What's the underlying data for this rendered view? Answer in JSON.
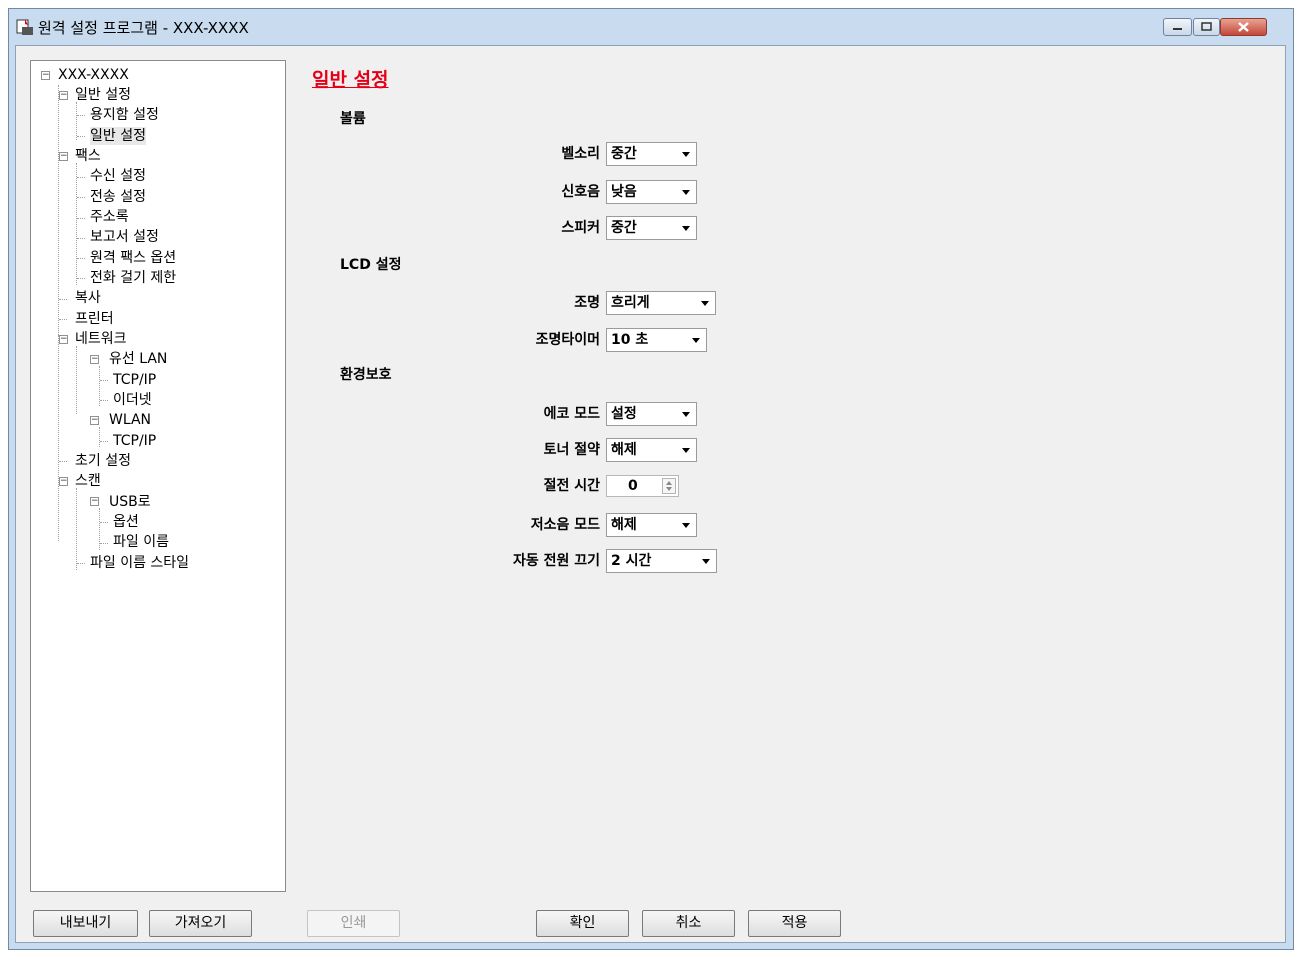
{
  "window": {
    "title": "원격 설정 프로그램 - XXX-XXXX",
    "controls": [
      "minimize-icon",
      "maximize-icon",
      "close-icon"
    ]
  },
  "tree": {
    "items": [
      {
        "label": "XXX-XXXX"
      },
      {
        "label": "일반 설정"
      },
      {
        "label": "용지함 설정"
      },
      {
        "label": "일반 설정",
        "selected": true
      },
      {
        "label": "팩스"
      },
      {
        "label": "수신 설정"
      },
      {
        "label": "전송 설정"
      },
      {
        "label": "주소록"
      },
      {
        "label": "보고서 설정"
      },
      {
        "label": "원격 팩스 옵션"
      },
      {
        "label": "전화 걸기 제한"
      },
      {
        "label": "복사"
      },
      {
        "label": "프린터"
      },
      {
        "label": "네트워크"
      },
      {
        "label": "유선 LAN"
      },
      {
        "label": "TCP/IP"
      },
      {
        "label": "이더넷"
      },
      {
        "label": "WLAN"
      },
      {
        "label": "TCP/IP"
      },
      {
        "label": "초기 설정"
      },
      {
        "label": "스캔"
      },
      {
        "label": "USB로"
      },
      {
        "label": "옵션"
      },
      {
        "label": "파일 이름"
      },
      {
        "label": "파일 이름 스타일"
      }
    ]
  },
  "main": {
    "page_title": "일반 설정",
    "sections": {
      "volume": "볼륨",
      "lcd": "LCD 설정",
      "eco": "환경보호"
    },
    "fields": {
      "ring": {
        "label": "벨소리",
        "value": "중간"
      },
      "beep": {
        "label": "신호음",
        "value": "낮음"
      },
      "speaker": {
        "label": "스피커",
        "value": "중간"
      },
      "backlight": {
        "label": "조명",
        "value": "흐리게"
      },
      "dim_timer": {
        "label": "조명타이머",
        "value": "10 초"
      },
      "eco_mode": {
        "label": "에코 모드",
        "value": "설정"
      },
      "toner_save": {
        "label": "토너 절약",
        "value": "해제"
      },
      "sleep_time": {
        "label": "절전 시간",
        "value": "0"
      },
      "quiet_mode": {
        "label": "저소음 모드",
        "value": "해제"
      },
      "auto_power_off": {
        "label": "자동 전원 끄기",
        "value": "2 시간"
      }
    }
  },
  "footer": {
    "export": "내보내기",
    "import": "가져오기",
    "print": "인쇄",
    "ok": "확인",
    "cancel": "취소",
    "apply": "적용"
  }
}
